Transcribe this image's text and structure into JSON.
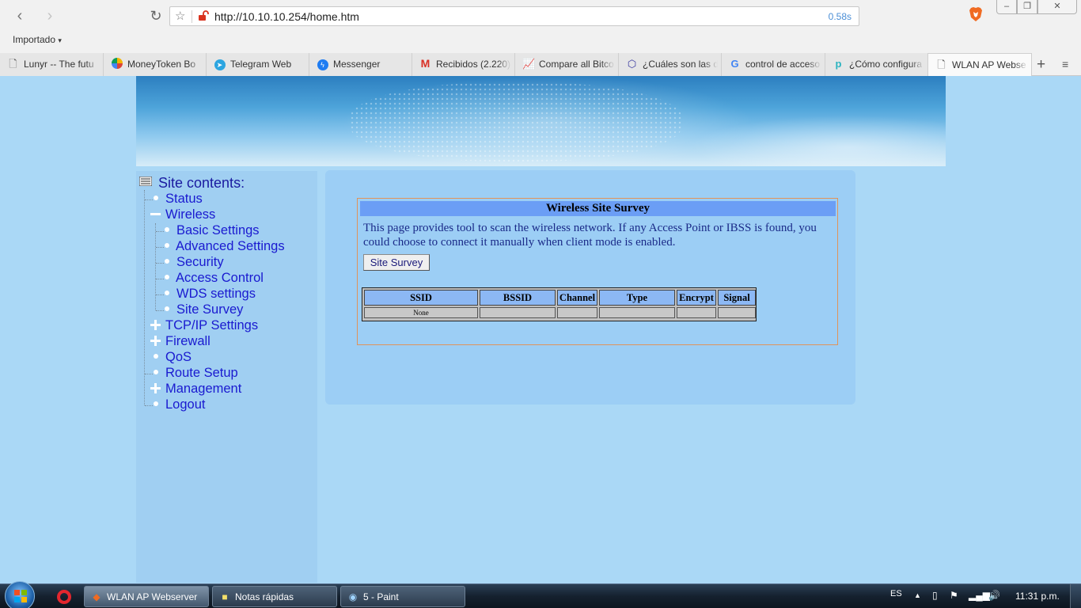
{
  "browser": {
    "url": "http://10.10.10.254/home.htm",
    "load_time": "0.58s",
    "bookmark_folder": "Importado",
    "tabs": [
      {
        "label": "Lunyr -- The futu",
        "icon": "page-icon"
      },
      {
        "label": "MoneyToken Bo",
        "icon": "moneytoken-icon"
      },
      {
        "label": "Telegram Web",
        "icon": "telegram-icon"
      },
      {
        "label": "Messenger",
        "icon": "messenger-icon"
      },
      {
        "label": "Recibidos (2.220)",
        "icon": "gmail-icon"
      },
      {
        "label": "Compare all Bitco",
        "icon": "chart-icon"
      },
      {
        "label": "¿Cuáles son las d",
        "icon": "cube-icon"
      },
      {
        "label": "control de acceso",
        "icon": "google-icon"
      },
      {
        "label": "¿Cómo configura",
        "icon": "p-icon"
      },
      {
        "label": "WLAN AP Webse",
        "icon": "page-icon"
      }
    ],
    "new_tab_label": "+",
    "tab_menu_label": "≡"
  },
  "sidebar": {
    "title": "Site contents:",
    "items": {
      "status": "Status",
      "wireless": "Wireless",
      "basic_settings": "Basic Settings",
      "advanced_settings": "Advanced Settings",
      "security": "Security",
      "access_control": "Access Control",
      "wds_settings": "WDS settings",
      "site_survey": "Site Survey",
      "tcpip_settings": "TCP/IP Settings",
      "firewall": "Firewall",
      "qos": "QoS",
      "route_setup": "Route Setup",
      "management": "Management",
      "logout": "Logout"
    }
  },
  "survey": {
    "title": "Wireless Site Survey",
    "description": "This page provides tool to scan the wireless network. If any Access Point or IBSS is found, you could choose to connect it manually when client mode is enabled.",
    "button_label": "Site Survey",
    "columns": [
      "SSID",
      "BSSID",
      "Channel",
      "Type",
      "Encrypt",
      "Signal"
    ],
    "rows": [
      [
        "None",
        "",
        "",
        "",
        "",
        ""
      ]
    ]
  },
  "taskbar": {
    "buttons": [
      {
        "label": "WLAN AP Webserver",
        "active": true
      },
      {
        "label": "Notas rápidas",
        "active": false
      },
      {
        "label": "5 - Paint",
        "active": false
      }
    ],
    "language": "ES",
    "clock": "11:31 p.m."
  },
  "colors": {
    "page_background": "#aad8f6",
    "menu_link": "#1a1ad0",
    "survey_header": "#6b9ef5",
    "table_header": "#8cb8f4",
    "box_border": "#e0935a"
  }
}
